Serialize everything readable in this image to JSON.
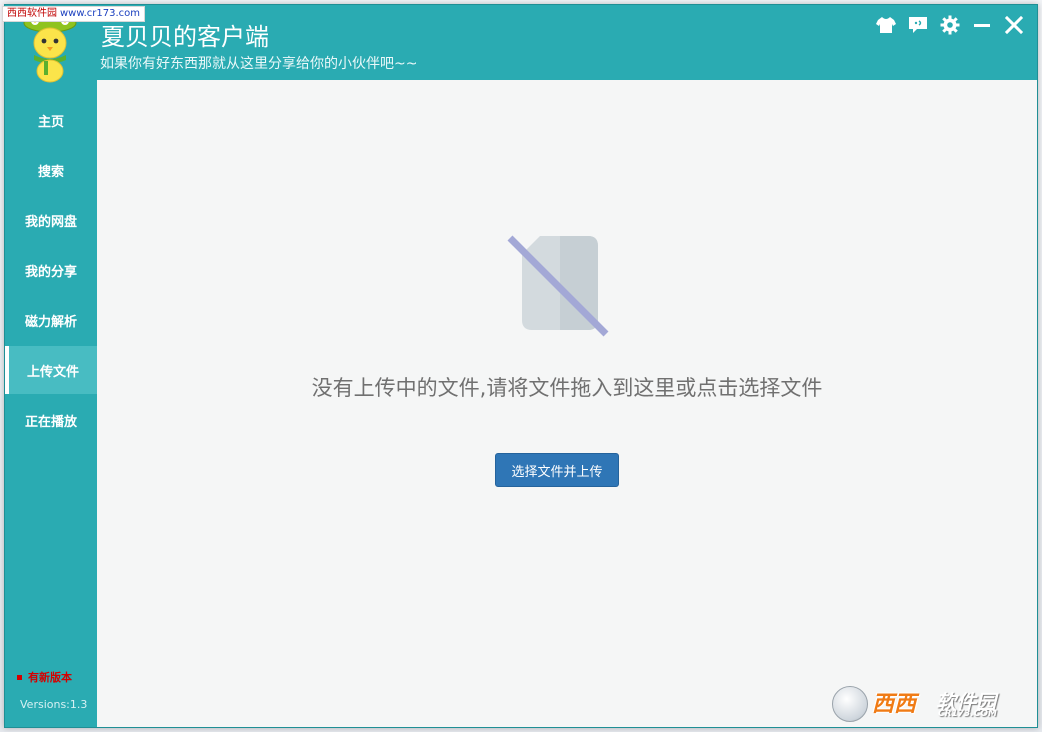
{
  "watermark": {
    "top_left_site": "西西软件园",
    "top_left_url": "www.cr173.com",
    "bottom_right_main": "西西",
    "bottom_right_soft": "软件园",
    "bottom_right_domain": "CR173.COM"
  },
  "header": {
    "title": "夏贝贝的客户端",
    "subtitle": "如果你有好东西那就从这里分享给你的小伙伴吧~~",
    "controls": [
      {
        "name": "tshirt-icon"
      },
      {
        "name": "chat-icon"
      },
      {
        "name": "gear-icon"
      },
      {
        "name": "minimize-icon"
      },
      {
        "name": "close-icon"
      }
    ]
  },
  "sidebar": {
    "items": [
      {
        "label": "主页",
        "active": false
      },
      {
        "label": "搜索",
        "active": false
      },
      {
        "label": "我的网盘",
        "active": false
      },
      {
        "label": "我的分享",
        "active": false
      },
      {
        "label": "磁力解析",
        "active": false
      },
      {
        "label": "上传文件",
        "active": true
      },
      {
        "label": "正在播放",
        "active": false
      }
    ],
    "new_version": "有新版本",
    "version": "Versions:1.3"
  },
  "main": {
    "empty_message": "没有上传中的文件,请将文件拖入到这里或点击选择文件",
    "upload_button": "选择文件并上传"
  },
  "colors": {
    "header_bg": "#2aabb2",
    "sidebar_active_bg": "#48bcc2",
    "content_bg": "#f5f6f6",
    "button_bg": "#2f76b6",
    "new_version_text": "#d40000"
  }
}
